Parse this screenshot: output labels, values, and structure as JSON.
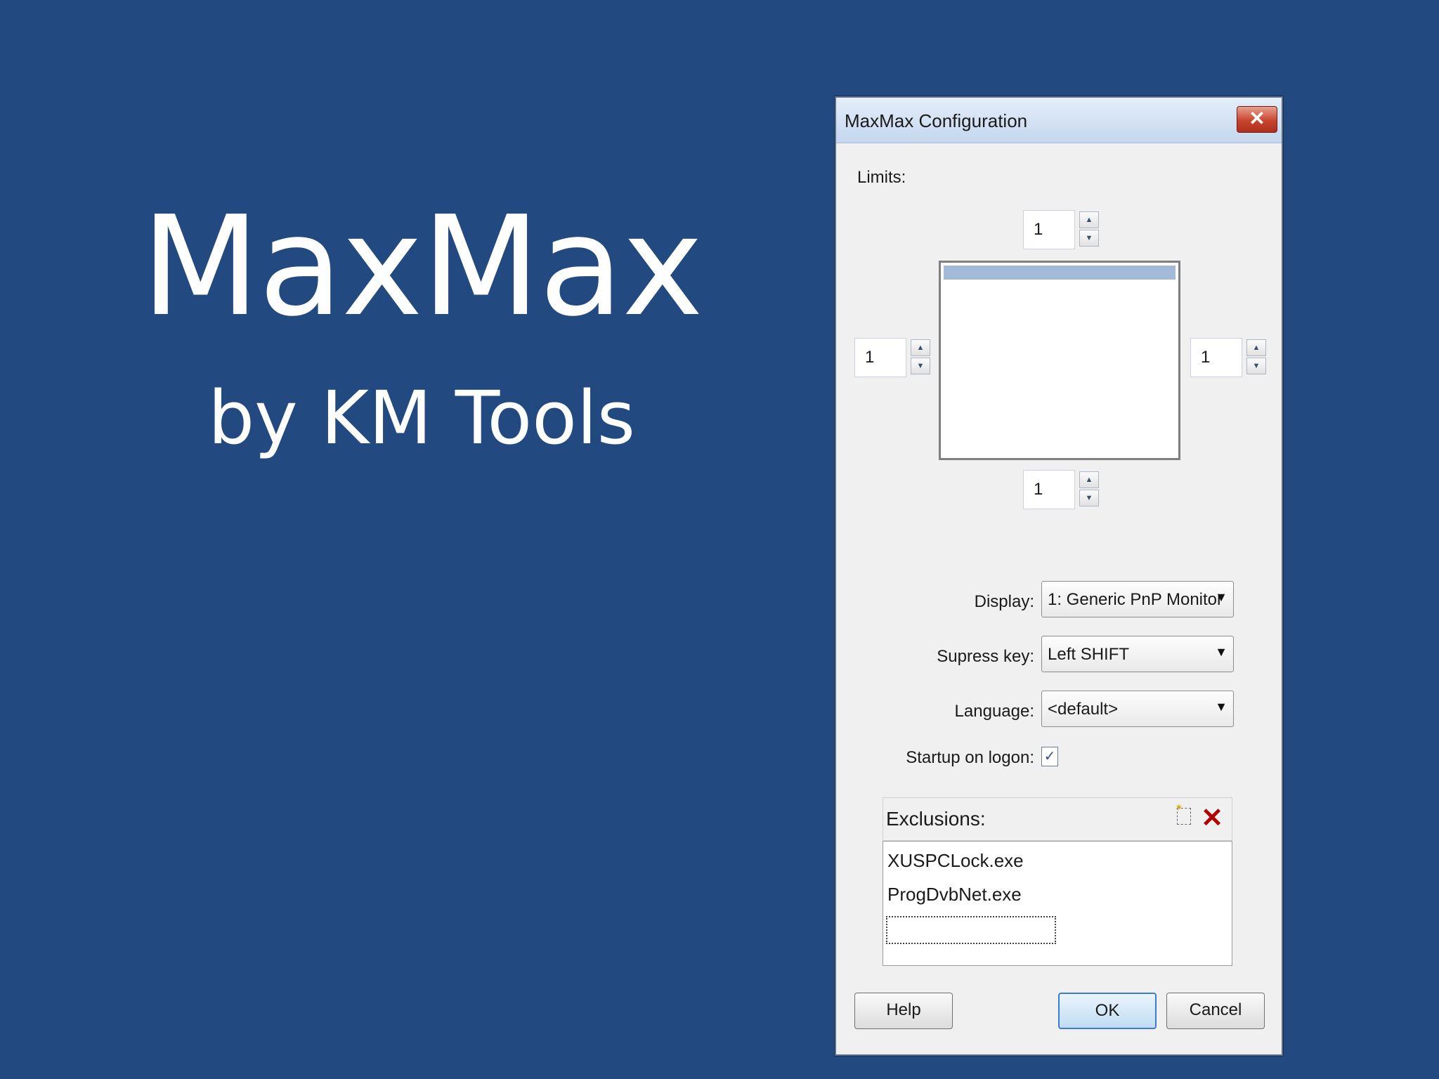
{
  "slide": {
    "title": "MaxMax",
    "subtitle": "by KM Tools"
  },
  "dialog": {
    "title": "MaxMax Configuration",
    "close_label": "✕",
    "limits_label": "Limits:",
    "limits": {
      "top": "1",
      "left": "1",
      "right": "1",
      "bottom": "1"
    },
    "display": {
      "label": "Display:",
      "value": "1: Generic PnP Monitor"
    },
    "suppress_key": {
      "label": "Supress key:",
      "value": "Left SHIFT"
    },
    "language": {
      "label": "Language:",
      "value": "<default>"
    },
    "startup": {
      "label": "Startup on logon:",
      "checked": true,
      "mark": "✓"
    },
    "exclusions": {
      "title": "Exclusions:",
      "items": [
        "XUSPCLock.exe",
        "ProgDvbNet.exe"
      ]
    },
    "buttons": {
      "help": "Help",
      "ok": "OK",
      "cancel": "Cancel"
    }
  },
  "icons": {
    "close": "close-icon",
    "add": "add-item-icon",
    "delete": "delete-icon",
    "up": "spin-up-arrow",
    "down": "spin-down-arrow",
    "dropdown": "dropdown-caret"
  }
}
